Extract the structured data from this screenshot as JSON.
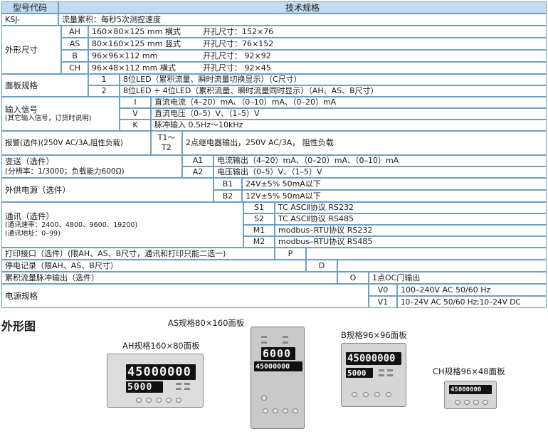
{
  "headers": {
    "model_code": "型号代码",
    "tech_spec": "技术规格"
  },
  "model": {
    "prefix": "KSJ-",
    "desc": "流量累积：每秒5次测控速度"
  },
  "dimensions": {
    "category": "外形尺寸",
    "rows": [
      {
        "code": "AH",
        "spec": "160×80×125 mm  横式",
        "cutout": "开孔尺寸：152×76"
      },
      {
        "code": "AS",
        "spec": "80×160×125 mm  竖式",
        "cutout": "开孔尺寸：76×152"
      },
      {
        "code": "B",
        "spec": "96×96×112 mm",
        "cutout": "开孔尺寸：  92×92"
      },
      {
        "code": "CH",
        "spec": "96×48×112 mm  横式",
        "cutout": "开孔尺寸：  92×45"
      }
    ]
  },
  "panel": {
    "category": "面板规格",
    "rows": [
      {
        "code": "1",
        "spec": "8位LED（累积流量、瞬时流量切换显示）（C尺寸）"
      },
      {
        "code": "2",
        "spec": "8位LED + 4位LED（累积流量、瞬时流量同时显示）（AH、AS、B尺寸）"
      }
    ]
  },
  "input": {
    "category": "输入信号",
    "note": "(其它输入信号，订货时说明)",
    "rows": [
      {
        "code": "I",
        "spec": "直流电流（4–20）mA、（0–10）mA、（0–20）mA"
      },
      {
        "code": "V",
        "spec": "直流电压（0–5）V、（1–5）V"
      },
      {
        "code": "K",
        "spec": "脉冲输入 0.5Hz～10kHz"
      }
    ]
  },
  "alarm": {
    "category": "报警(选件)(250V AC/3A,阻性负载)",
    "code_line1": "T1～",
    "code_line2": "T2",
    "spec": "2点继电器输出，250V AC/3A， 阻性负载"
  },
  "transmit": {
    "category": "变送（选件）",
    "note": "(分辨率：1/3000；负载能力600Ω)",
    "rows": [
      {
        "code": "A1",
        "spec": "电流输出（4–20）mA、（0–20）mA、（0–10）mA"
      },
      {
        "code": "A2",
        "spec": "电压输出（0–5）V、（1–5）V"
      }
    ]
  },
  "power_ext": {
    "category": "外供电源（选件）",
    "rows": [
      {
        "code": "B1",
        "spec": "24V±5%   50mA以下"
      },
      {
        "code": "B2",
        "spec": "12V±5%   50mA以下"
      }
    ]
  },
  "comm": {
    "category": "通讯（选件）",
    "note1": "(通讯速率：2400、4800、9600、19200)",
    "note2": "(通讯地址：0–99)",
    "rows": [
      {
        "code": "S1",
        "spec": "TC   ASCⅡ协议 RS232"
      },
      {
        "code": "S2",
        "spec": "TC   ASCⅡ协议 RS485"
      },
      {
        "code": "M1",
        "spec": "modbus–RTU协议 RS232"
      },
      {
        "code": "M2",
        "spec": "modbus–RTU协议 RS485"
      }
    ]
  },
  "print": {
    "category": "打印接口（选件）(限AH、AS、B尺寸，通讯和打印只能二选一)",
    "code": "P"
  },
  "poweroff": {
    "category": "停电记录（限AH、AS、B尺寸）",
    "code": "D"
  },
  "pulse_out": {
    "category": "累积流量脉冲输出（选件）",
    "code": "O",
    "spec": "1点OC门输出"
  },
  "supply": {
    "category": "电源规格",
    "rows": [
      {
        "code": "V0",
        "spec": "100–240V  AC  50/60  Hz"
      },
      {
        "code": "V1",
        "spec": "10–24V  AC 50/60 Hz;10–24V  DC"
      }
    ]
  },
  "outline": {
    "title": "外形图",
    "ah": {
      "label": "AH规格160×80面板",
      "main": "45000000",
      "sub": "5000"
    },
    "as": {
      "label": "AS规格80×160面板",
      "main": "45000000",
      "sub": "6000"
    },
    "b": {
      "label": "B规格96×96面板",
      "main": "45000000",
      "sub": "5000"
    },
    "ch": {
      "label": "CH规格96×48面板",
      "main": "45000000"
    }
  }
}
